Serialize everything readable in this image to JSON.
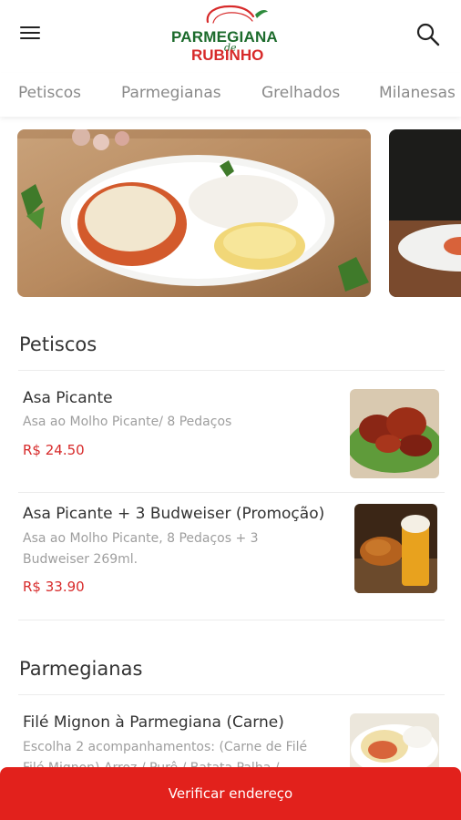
{
  "header": {
    "logo": {
      "top": "PARMEGIANA",
      "middle": "de",
      "bottom": "RUBINHO"
    }
  },
  "tabs": [
    {
      "label": "Petiscos"
    },
    {
      "label": "Parmegianas"
    },
    {
      "label": "Grelhados"
    },
    {
      "label": "Milanesas"
    }
  ],
  "sections": [
    {
      "title": "Petiscos",
      "items": [
        {
          "name": "Asa Picante",
          "description": "Asa ao Molho Picante/ 8 Pedaços",
          "price": "R$ 24.50"
        },
        {
          "name": "Asa Picante + 3 Budweiser (Promoção)",
          "description_line1": "Asa ao Molho Picante, 8 Pedaços + 3",
          "description_line2": "Budweiser 269ml.",
          "price": "R$ 33.90"
        }
      ]
    },
    {
      "title": "Parmegianas",
      "items": [
        {
          "name": "Filé Mignon à Parmegiana (Carne)",
          "description_line1": "Escolha 2 acompanhamentos: (Carne de Filé",
          "description_line2": "Filé Mignon) Arroz / Purê / Batata Palha /"
        }
      ]
    }
  ],
  "cta": {
    "label": "Verificar endereço"
  },
  "colors": {
    "accent": "#e2211c",
    "price": "#d72a2a",
    "logo_green": "#1c6b2c"
  }
}
